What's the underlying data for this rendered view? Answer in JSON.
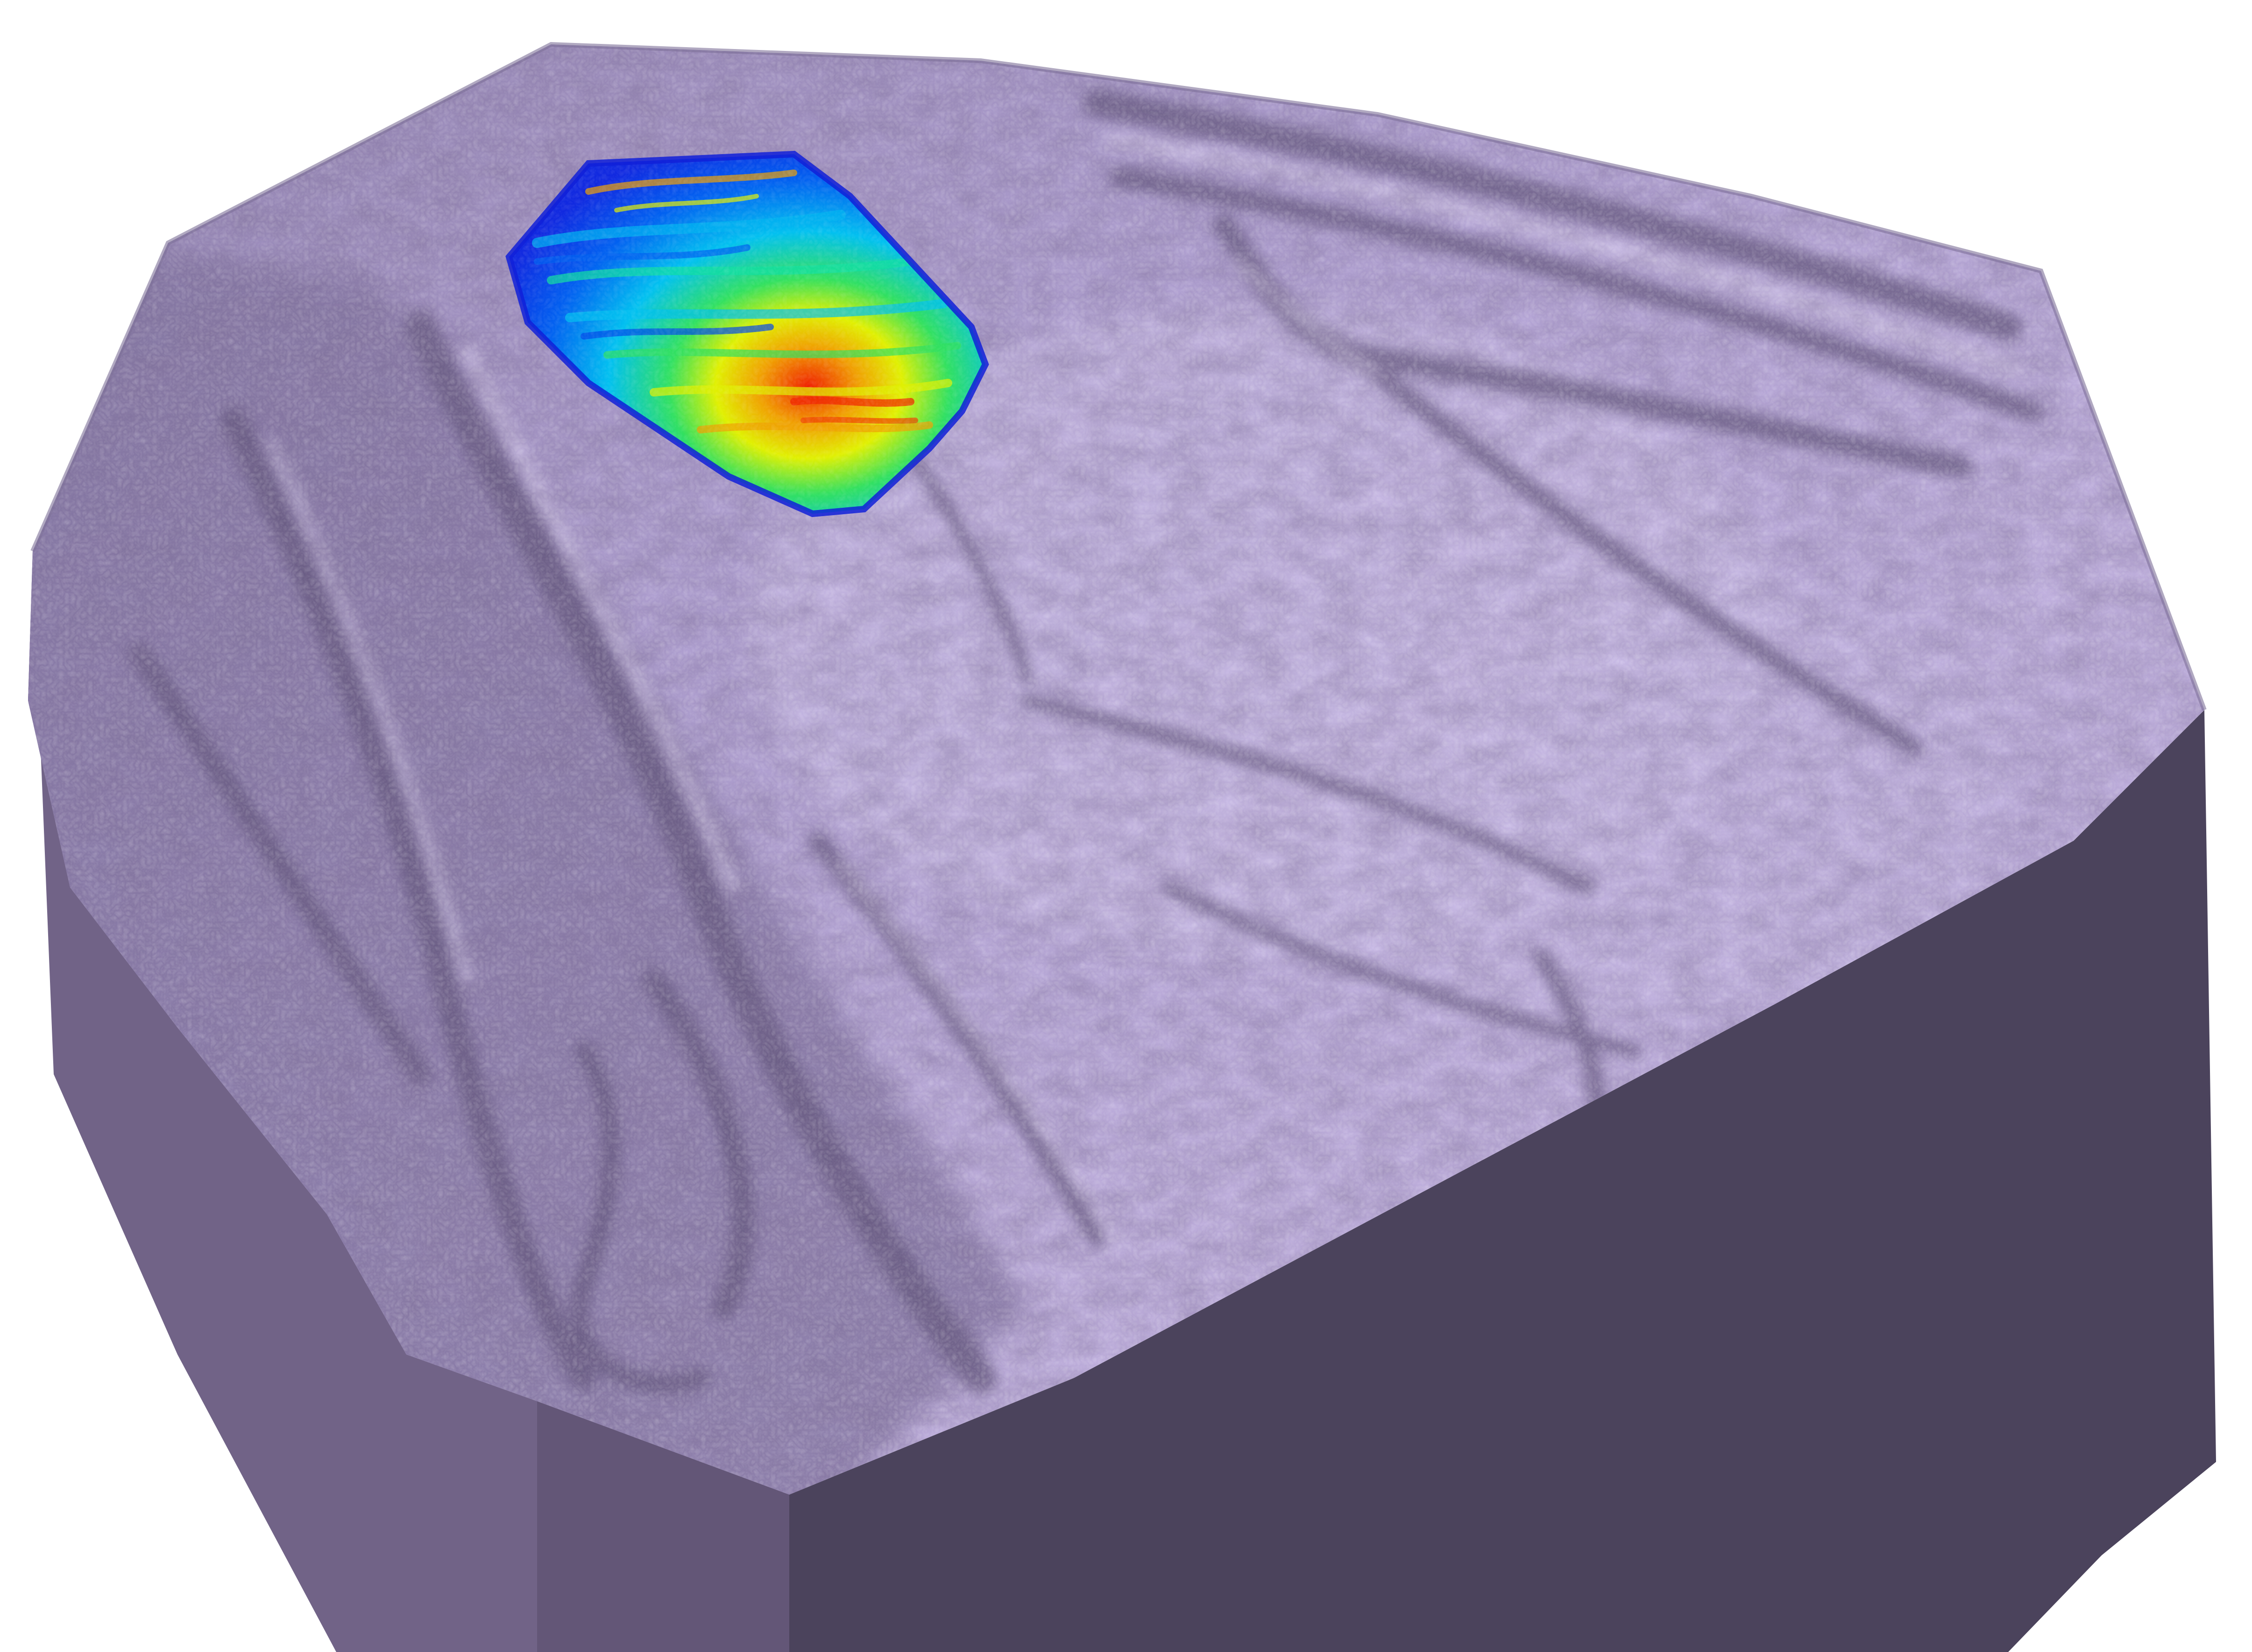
{
  "scene": {
    "subject": "terrain-block-model",
    "colors": {
      "background": "#ffffff",
      "terrain_top_light": "#c8b8e6",
      "terrain_top_mid": "#a696c8",
      "terrain_top_dark": "#6f608f",
      "side_left": "#716387",
      "side_front": "#4b435c",
      "ridge_shadow": "#5a4d73",
      "ridge_highlight": "#ddd2f2",
      "overlay_low": "#1030e0",
      "overlay_mid_low": "#00b4f0",
      "overlay_mid": "#10e0a0",
      "overlay_mid_high": "#f0f000",
      "overlay_high": "#f02000"
    },
    "overlay": {
      "name": "colormap-overlay-patch",
      "colormap": "jet"
    }
  }
}
